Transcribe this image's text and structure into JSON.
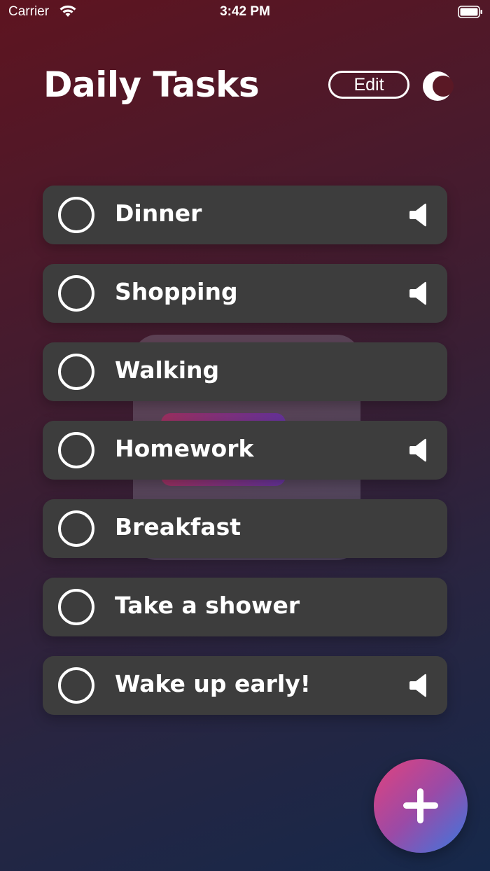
{
  "status_bar": {
    "carrier": "Carrier",
    "time": "3:42 PM"
  },
  "header": {
    "title": "Daily Tasks",
    "edit_label": "Edit"
  },
  "tasks": [
    {
      "label": "Dinner",
      "done": false,
      "has_sound": true
    },
    {
      "label": "Shopping",
      "done": false,
      "has_sound": true
    },
    {
      "label": "Walking",
      "done": false,
      "has_sound": false
    },
    {
      "label": "Homework",
      "done": false,
      "has_sound": true
    },
    {
      "label": "Breakfast",
      "done": false,
      "has_sound": false
    },
    {
      "label": "Take a shower",
      "done": false,
      "has_sound": false
    },
    {
      "label": "Wake up early!",
      "done": false,
      "has_sound": true
    }
  ],
  "icons": {
    "theme": "moon-icon",
    "sound": "speaker-icon",
    "add": "plus-icon"
  },
  "colors": {
    "task_bg": "#3d3d3d",
    "fab_gradient": [
      "#e2427d",
      "#9b4aa6",
      "#3a78e0"
    ]
  }
}
